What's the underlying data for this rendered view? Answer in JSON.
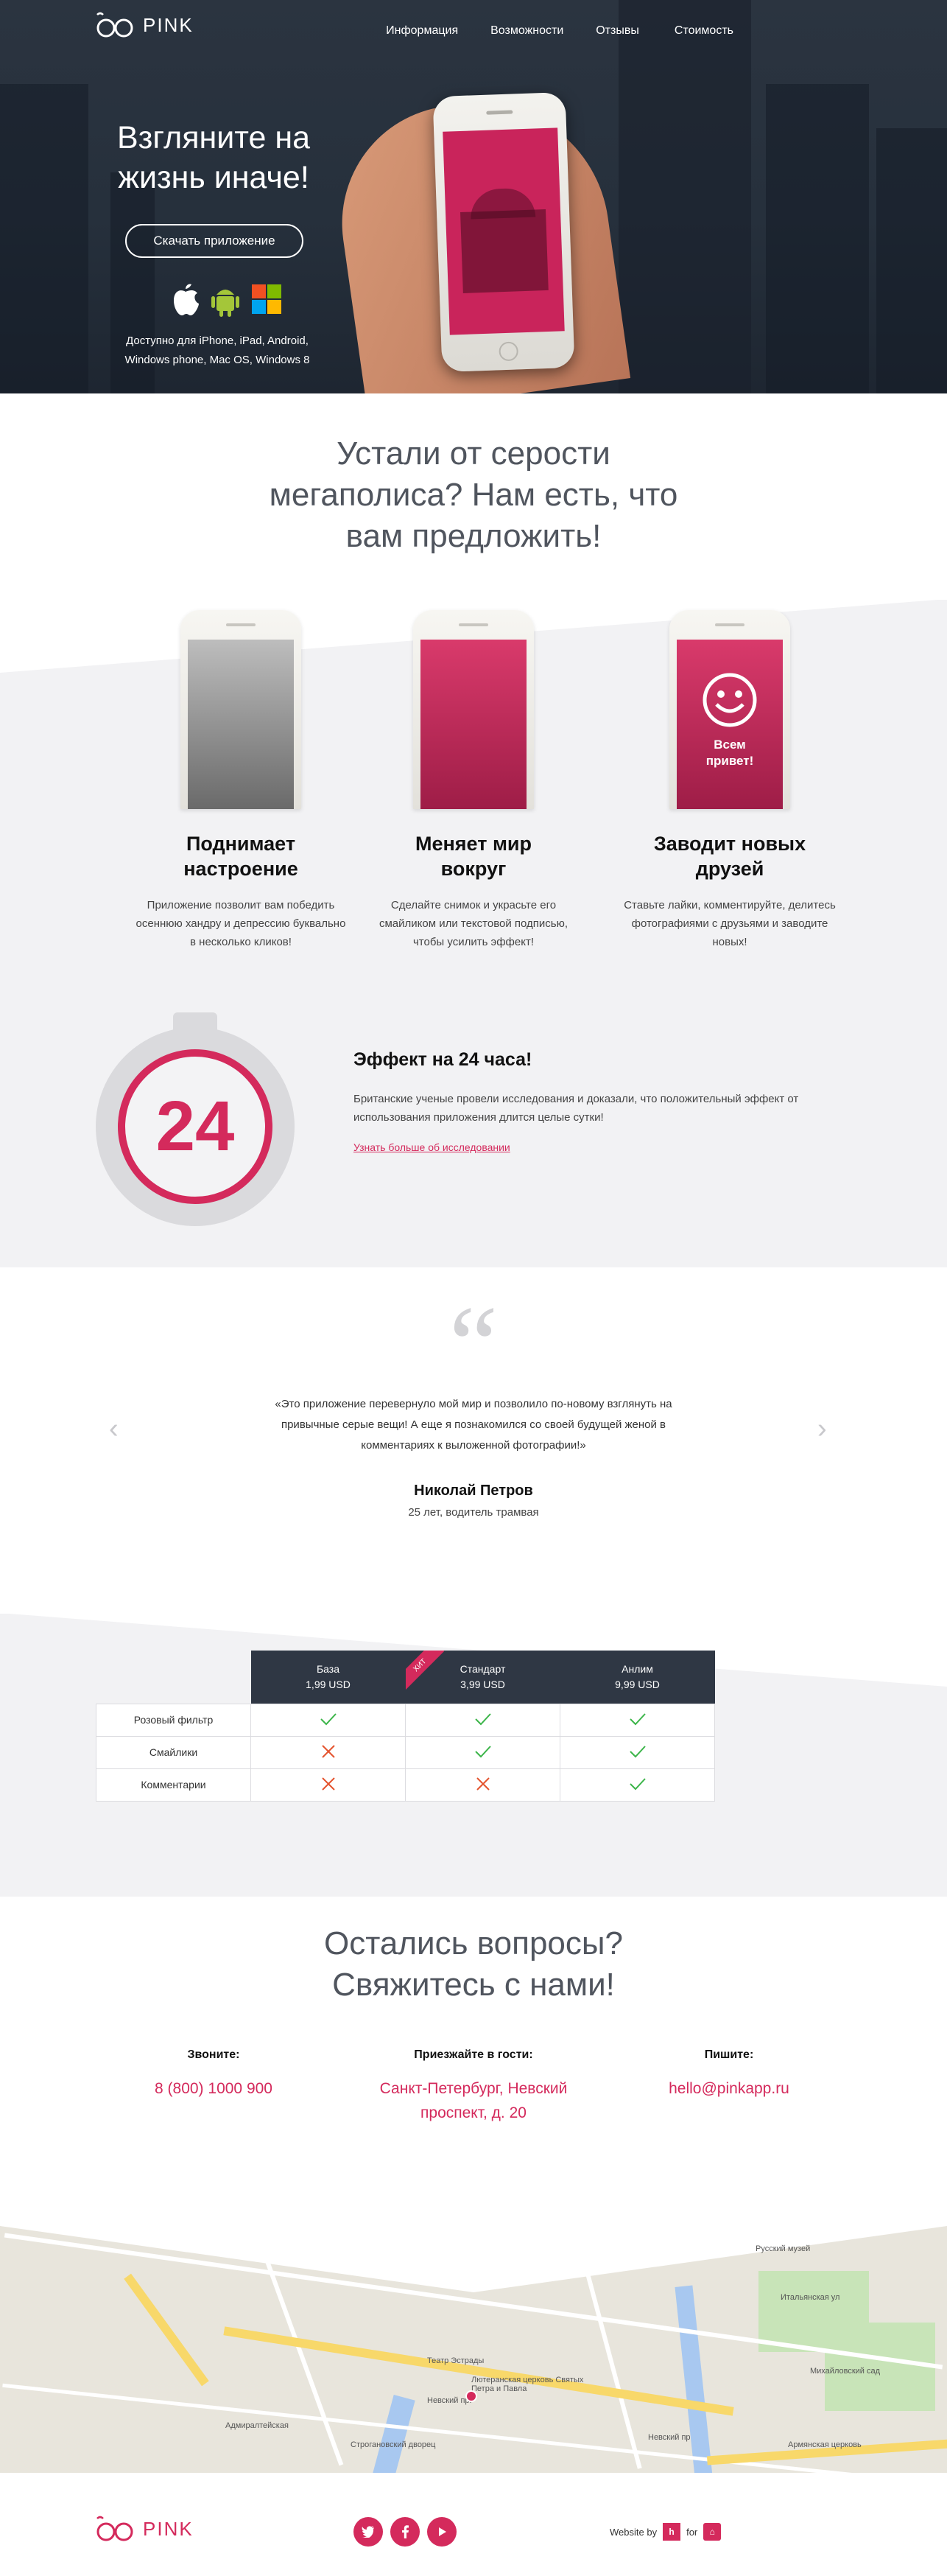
{
  "brand": {
    "name": "PINK",
    "accent": "#d42a5c",
    "dark": "#2f3744"
  },
  "nav": [
    {
      "label": "Информация"
    },
    {
      "label": "Возможности"
    },
    {
      "label": "Отзывы"
    },
    {
      "label": "Стоимость"
    }
  ],
  "hero": {
    "title": "Взгляните на жизнь иначе!",
    "cta": "Скачать приложение",
    "platforms": [
      "apple-icon",
      "android-icon",
      "windows-icon"
    ],
    "availability": "Доступно для iPhone, iPad, Android, Windows phone, Mac OS, Windows 8"
  },
  "intro": {
    "title": "Устали от серости мегаполиса? Нам есть, что вам предложить!"
  },
  "features": [
    {
      "title": "Поднимает настроение",
      "text": "Приложение позволит вам победить осеннюю хандру и депрессию буквально в несколько кликов!"
    },
    {
      "title": "Меняет мир вокруг",
      "text": "Сделайте снимок и украсьте его смайликом или текстовой подписью, чтобы усилить эффект!"
    },
    {
      "title": "Заводит новых друзей",
      "text": "Ставьте лайки, комментируйте, делитесь фотографиями с друзьями и заводите новых!",
      "screen_text": "Всем привет!"
    }
  ],
  "effect": {
    "timer": "24",
    "title": "Эффект на 24 часа!",
    "text": "Британские ученые провели исследования и доказали, что положительный эффект от использования приложения длится целые сутки!",
    "link": "Узнать больше об исследовании"
  },
  "review": {
    "quote_mark": "“",
    "text": "«Это приложение перевернуло мой мир и позволило по-новому взглянуть на привычные серые вещи! А еще я познакомился со своей будущей женой в комментариях к выложенной фотографии!»",
    "name": "Николай Петров",
    "meta": "25 лет, водитель трамвая",
    "prev": "‹",
    "next": "›"
  },
  "pricing": {
    "plans": [
      {
        "name": "База",
        "price": "1,99 USD"
      },
      {
        "name": "Стандарт",
        "price": "3,99 USD",
        "ribbon": "ХИТ"
      },
      {
        "name": "Анлим",
        "price": "9,99 USD"
      }
    ],
    "rows": [
      {
        "label": "Розовый фильтр",
        "values": [
          true,
          true,
          true
        ]
      },
      {
        "label": "Смайлики",
        "values": [
          false,
          true,
          true
        ]
      },
      {
        "label": "Комментарии",
        "values": [
          false,
          false,
          true
        ]
      }
    ]
  },
  "contacts": {
    "title": "Остались вопросы? Свяжитесь с нами!",
    "phone_label": "Звоните:",
    "phone": "8 (800) 1000 900",
    "address_label": "Приезжайте в гости:",
    "address": "Санкт-Петербург, Невский проспект, д. 20",
    "email_label": "Пишите:",
    "email": "hello@pinkapp.ru"
  },
  "map": {
    "labels": [
      "Невский пр.",
      "Адмиралтейская",
      "Строгановский дворец",
      "Театр Эстрады",
      "Лютеранская церковь Святых Петра и Павла",
      "Русский музей",
      "Михайловский сад",
      "Невский пр",
      "Итальянская ул",
      "Армянская церковь"
    ]
  },
  "footer": {
    "website_by": "Website by",
    "for": "for",
    "socials": [
      "twitter-icon",
      "facebook-icon",
      "youtube-icon"
    ]
  }
}
